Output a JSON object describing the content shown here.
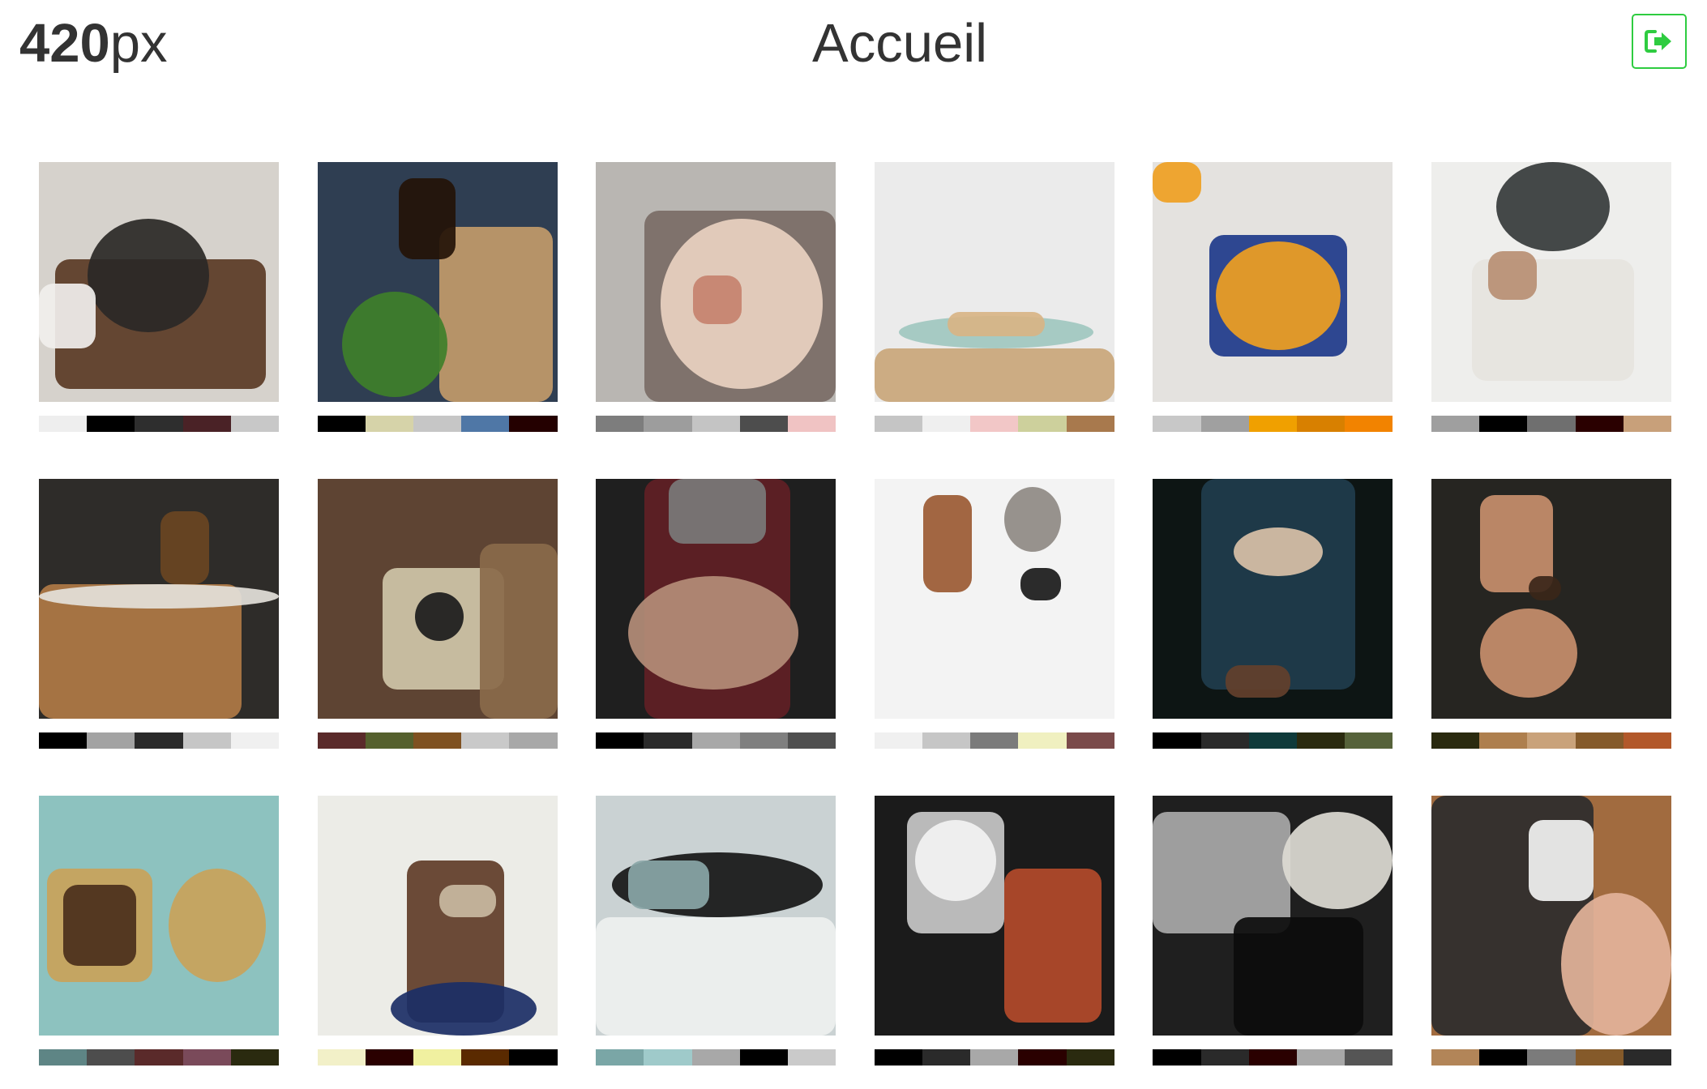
{
  "header": {
    "brand_number": "420",
    "brand_unit": "px",
    "title": "Accueil",
    "logout_icon": "sign-out-icon",
    "accent_color": "#2ecc40"
  },
  "photos": [
    {
      "subject": "burger-plate",
      "bg": "#d6d2cc",
      "base": "#5a3a25",
      "accent": "#2a2826",
      "accent2": "#f1efed",
      "palette": [
        "#eeeeee",
        "#000000",
        "#2e2e2e",
        "#4a2226",
        "#c8c8c8"
      ]
    },
    {
      "subject": "beer-and-burger",
      "bg": "#2f3e52",
      "base": "#c29a6a",
      "accent": "#3f7f2a",
      "accent2": "#241208",
      "palette": [
        "#000000",
        "#d6d3a9",
        "#c6c6c6",
        "#4f77a6",
        "#240000"
      ]
    },
    {
      "subject": "macarons-bowl",
      "bg": "#b9b6b2",
      "base": "#e9d1c1",
      "accent": "#c6826e",
      "accent2": "#7a6d66",
      "palette": [
        "#7d7d7d",
        "#9d9d9d",
        "#c4c4c4",
        "#4d4d4d",
        "#f0c3c3"
      ]
    },
    {
      "subject": "pancakes-plate",
      "bg": "#ebebeb",
      "base": "#c9a679",
      "accent": "#9fc7bf",
      "accent2": "#d8b485",
      "palette": [
        "#c5c5c5",
        "#efefef",
        "#f2c7c7",
        "#cdd09c",
        "#a8794d"
      ]
    },
    {
      "subject": "pumpkin-soup",
      "bg": "#e4e2df",
      "base": "#ef9f22",
      "accent": "#1e3a8a",
      "accent2": "#c2c0bb",
      "palette": [
        "#c8c8c8",
        "#a0a0a0",
        "#f0a000",
        "#d88000",
        "#f28300"
      ]
    },
    {
      "subject": "noodle-soup",
      "bg": "#eeeeec",
      "base": "#e6e4de",
      "accent": "#b88f73",
      "accent2": "#35393a",
      "palette": [
        "#9f9f9f",
        "#000000",
        "#6f6f6f",
        "#2a0000",
        "#c8a07a"
      ]
    },
    {
      "subject": "bakery-counter",
      "bg": "#2e2c29",
      "base": "#b07a45",
      "accent": "#e4e1da",
      "accent2": "#6a4522",
      "palette": [
        "#000000",
        "#a3a3a3",
        "#2a2a2a",
        "#c6c6c6",
        "#f0f0f0"
      ]
    },
    {
      "subject": "coffee-cookies-table",
      "bg": "#5e4433",
      "base": "#cfc6a8",
      "accent": "#1b1b1b",
      "accent2": "#8a6a4a",
      "palette": [
        "#5a2a2a",
        "#55602d",
        "#7f5121",
        "#c9c9c9",
        "#a8a8a8"
      ]
    },
    {
      "subject": "tattooed-hands",
      "bg": "#1f1f1f",
      "base": "#b48d78",
      "accent": "#611f25",
      "accent2": "#7a7a7a",
      "palette": [
        "#000000",
        "#2a2a2a",
        "#a8a8a8",
        "#7f7f7f",
        "#4f4f4f"
      ]
    },
    {
      "subject": "flatlay-boots",
      "bg": "#f3f3f3",
      "base": "#9b5a33",
      "accent": "#8f8a84",
      "accent2": "#1a1a1a",
      "palette": [
        "#f0f0f0",
        "#c6c6c6",
        "#7b7b7b",
        "#f0f0c0",
        "#7a4a4a"
      ]
    },
    {
      "subject": "man-checking-watch",
      "bg": "#0d1514",
      "base": "#1f3d4d",
      "accent": "#d9c1a8",
      "accent2": "#63402c",
      "palette": [
        "#000000",
        "#2a2a2a",
        "#0f3a3a",
        "#2a2a0f",
        "#56623a"
      ]
    },
    {
      "subject": "wrist-watch-dark",
      "bg": "#262521",
      "base": "#c78e6c",
      "accent": "#3a2619",
      "accent2": "#b9a692",
      "palette": [
        "#2a2a0f",
        "#ae7f4e",
        "#c9a27a",
        "#855a2a",
        "#b2582a"
      ]
    },
    {
      "subject": "round-sunglasses",
      "bg": "#8dc2bf",
      "base": "#c9a35a",
      "accent": "#4a2f1b",
      "accent2": "#e9b79f",
      "palette": [
        "#5e8585",
        "#4d4d4d",
        "#5a2a2a",
        "#7a4a5a",
        "#2a2a0f"
      ]
    },
    {
      "subject": "woman-sunglasses",
      "bg": "#ecece7",
      "base": "#5f3c28",
      "accent": "#1b2e66",
      "accent2": "#c9b9a1",
      "palette": [
        "#f2f0c8",
        "#2a0000",
        "#f0f0a0",
        "#5a2a00",
        "#000000"
      ]
    },
    {
      "subject": "glasses-on-paper",
      "bg": "#cad2d3",
      "base": "#eef0ef",
      "accent": "#161616",
      "accent2": "#8aa6a7",
      "palette": [
        "#7aa6a6",
        "#9fcaca",
        "#a8a8a8",
        "#000000",
        "#cacaca"
      ]
    },
    {
      "subject": "laptop-desk",
      "bg": "#1b1b1b",
      "base": "#c8c8c8",
      "accent": "#f2f2f2",
      "accent2": "#b34a2a",
      "palette": [
        "#000000",
        "#2a2a2a",
        "#a8a8a8",
        "#2a0000",
        "#2a2a0f"
      ]
    },
    {
      "subject": "laptop-camera",
      "bg": "#1f1f1f",
      "base": "#a9a9a9",
      "accent": "#0c0c0c",
      "accent2": "#dddbd4",
      "palette": [
        "#000000",
        "#2a2a2a",
        "#2a0000",
        "#a8a8a8",
        "#555555"
      ]
    },
    {
      "subject": "hands-typing-laptop",
      "bg": "#a16b3f",
      "base": "#2c2c2c",
      "accent": "#e3b39a",
      "accent2": "#f2f2f2",
      "palette": [
        "#b28558",
        "#000000",
        "#7b7b7b",
        "#855a2a",
        "#2a2a2a"
      ]
    }
  ]
}
